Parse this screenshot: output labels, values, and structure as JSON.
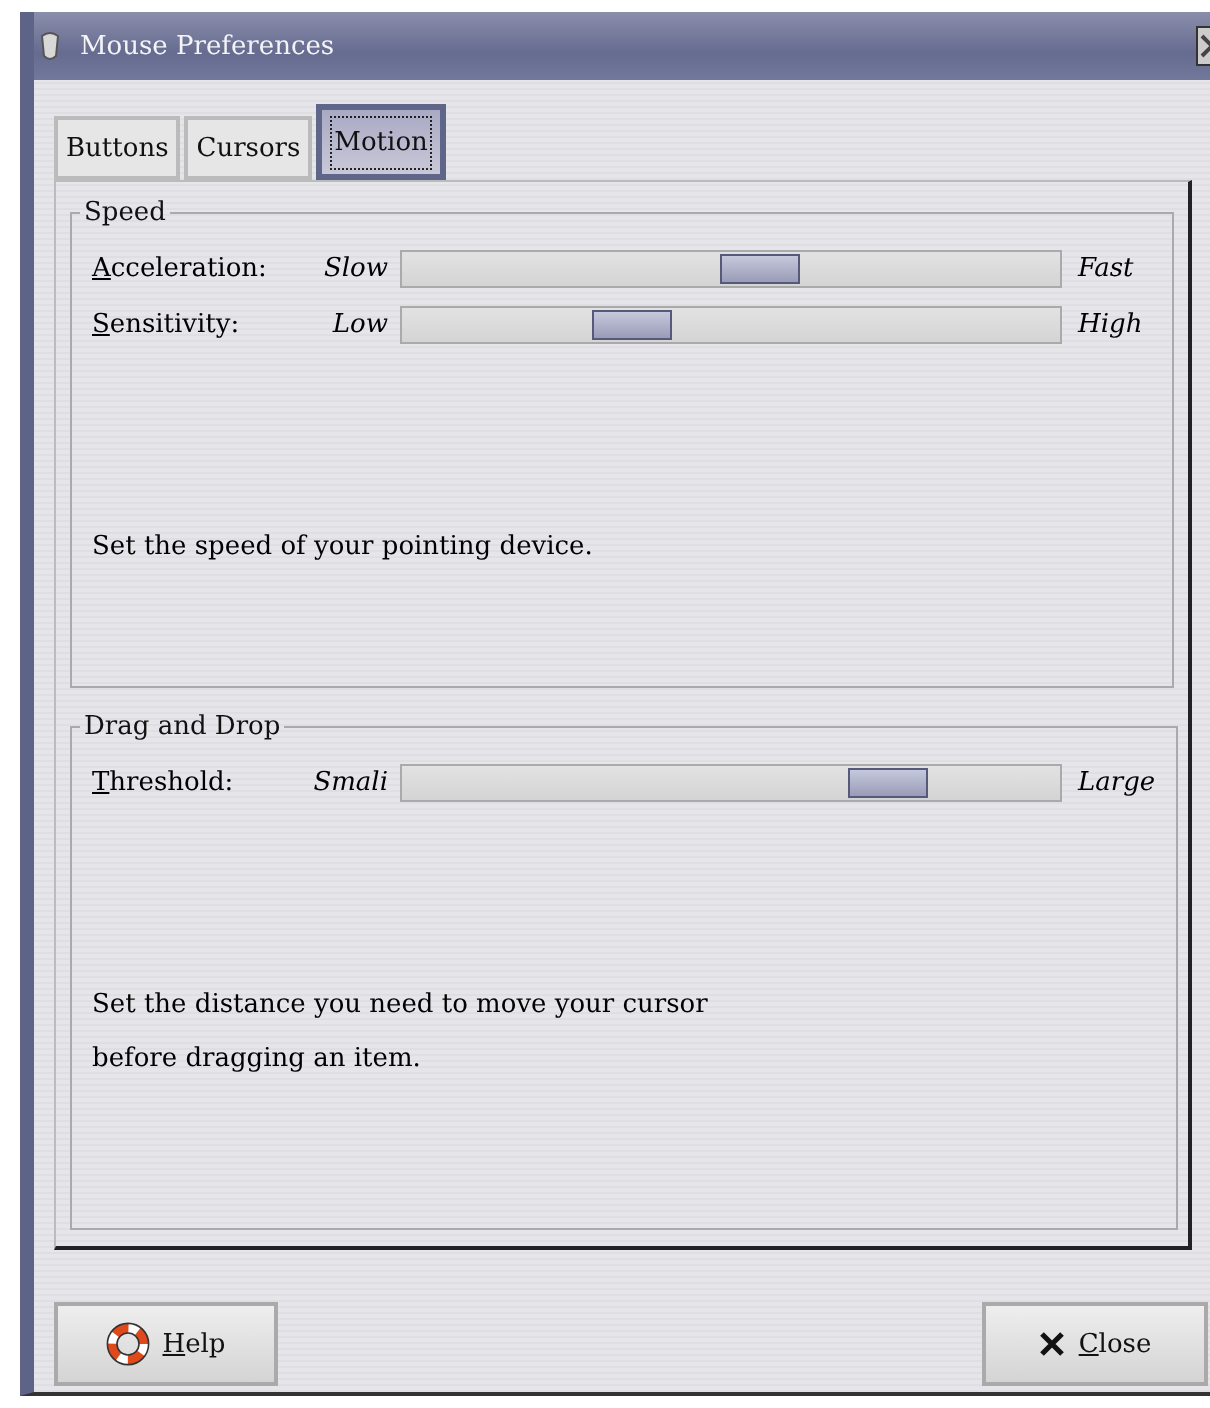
{
  "window": {
    "title": "Mouse Preferences"
  },
  "tabs": [
    {
      "label": "Buttons",
      "selected": false
    },
    {
      "label": "Cursors",
      "selected": false
    },
    {
      "label": "Motion",
      "selected": true
    }
  ],
  "groups": [
    {
      "title": "Speed",
      "sliders": [
        {
          "label": "Acceleration:",
          "min_label": "Slow",
          "max_label": "Fast",
          "level": 0.55
        },
        {
          "label": "Sensitivity:",
          "min_label": "Low",
          "max_label": "High",
          "level": 0.33
        }
      ],
      "description": [
        "Set the speed of your pointing device."
      ]
    },
    {
      "title": "Drag and Drop",
      "sliders": [
        {
          "label": "Threshold:",
          "min_label": "Smali",
          "max_label": "Large",
          "level": 0.77
        }
      ],
      "description": [
        "Set the distance you need to move your cursor",
        "before dragging an item."
      ]
    }
  ],
  "buttons": [
    {
      "kind": "help",
      "label": "Help"
    },
    {
      "kind": "close",
      "label": "Close"
    }
  ]
}
